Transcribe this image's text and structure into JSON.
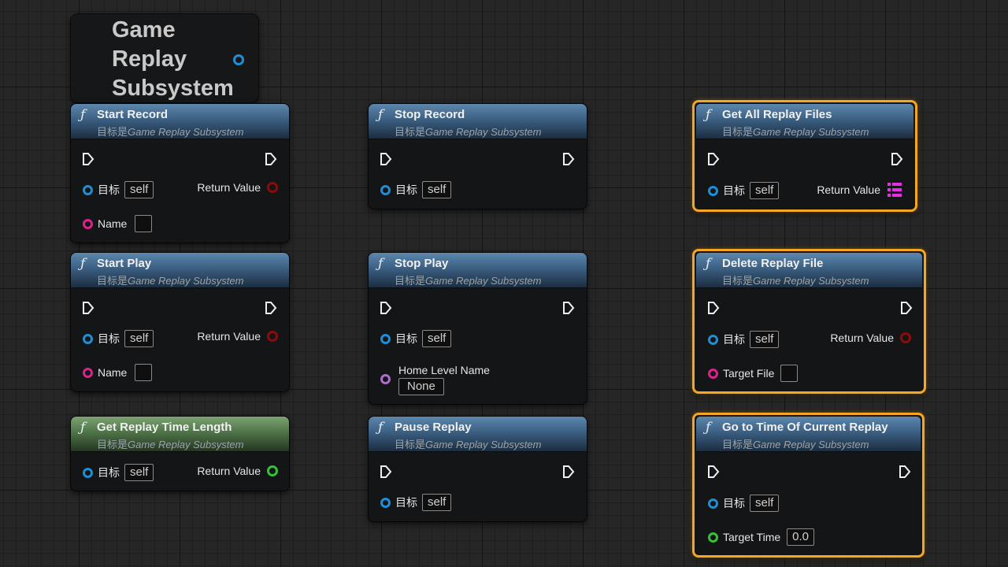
{
  "subsystem_node": {
    "title": "Game Replay Subsystem"
  },
  "common": {
    "subtitle_prefix": "目标是",
    "subtitle_target": "Game Replay Subsystem",
    "target_label": "目标",
    "self_value": "self",
    "return_value_label": "Return Value",
    "func_icon": "ƒ"
  },
  "nodes": {
    "start_record": {
      "title": "Start Record",
      "name_label": "Name"
    },
    "stop_record": {
      "title": "Stop Record"
    },
    "get_all_replay_files": {
      "title": "Get All Replay Files"
    },
    "start_play": {
      "title": "Start Play",
      "name_label": "Name"
    },
    "stop_play": {
      "title": "Stop Play",
      "home_level_label": "Home Level Name",
      "home_level_value": "None"
    },
    "delete_replay_file": {
      "title": "Delete Replay File",
      "target_file_label": "Target File"
    },
    "get_replay_time_length": {
      "title": "Get Replay Time Length"
    },
    "pause_replay": {
      "title": "Pause Replay"
    },
    "go_to_time": {
      "title": "Go to Time Of Current Replay",
      "target_time_label": "Target Time",
      "target_time_value": "0.0"
    }
  },
  "colors": {
    "selected_border": "#f5a623",
    "object_pin": "#1b8fd8",
    "string_pin": "#e0208c",
    "name_pin": "#b06bcf",
    "bool_pin": "#8e0b0b",
    "float_pin": "#37c13a",
    "array_pin": "#e62ee6"
  }
}
